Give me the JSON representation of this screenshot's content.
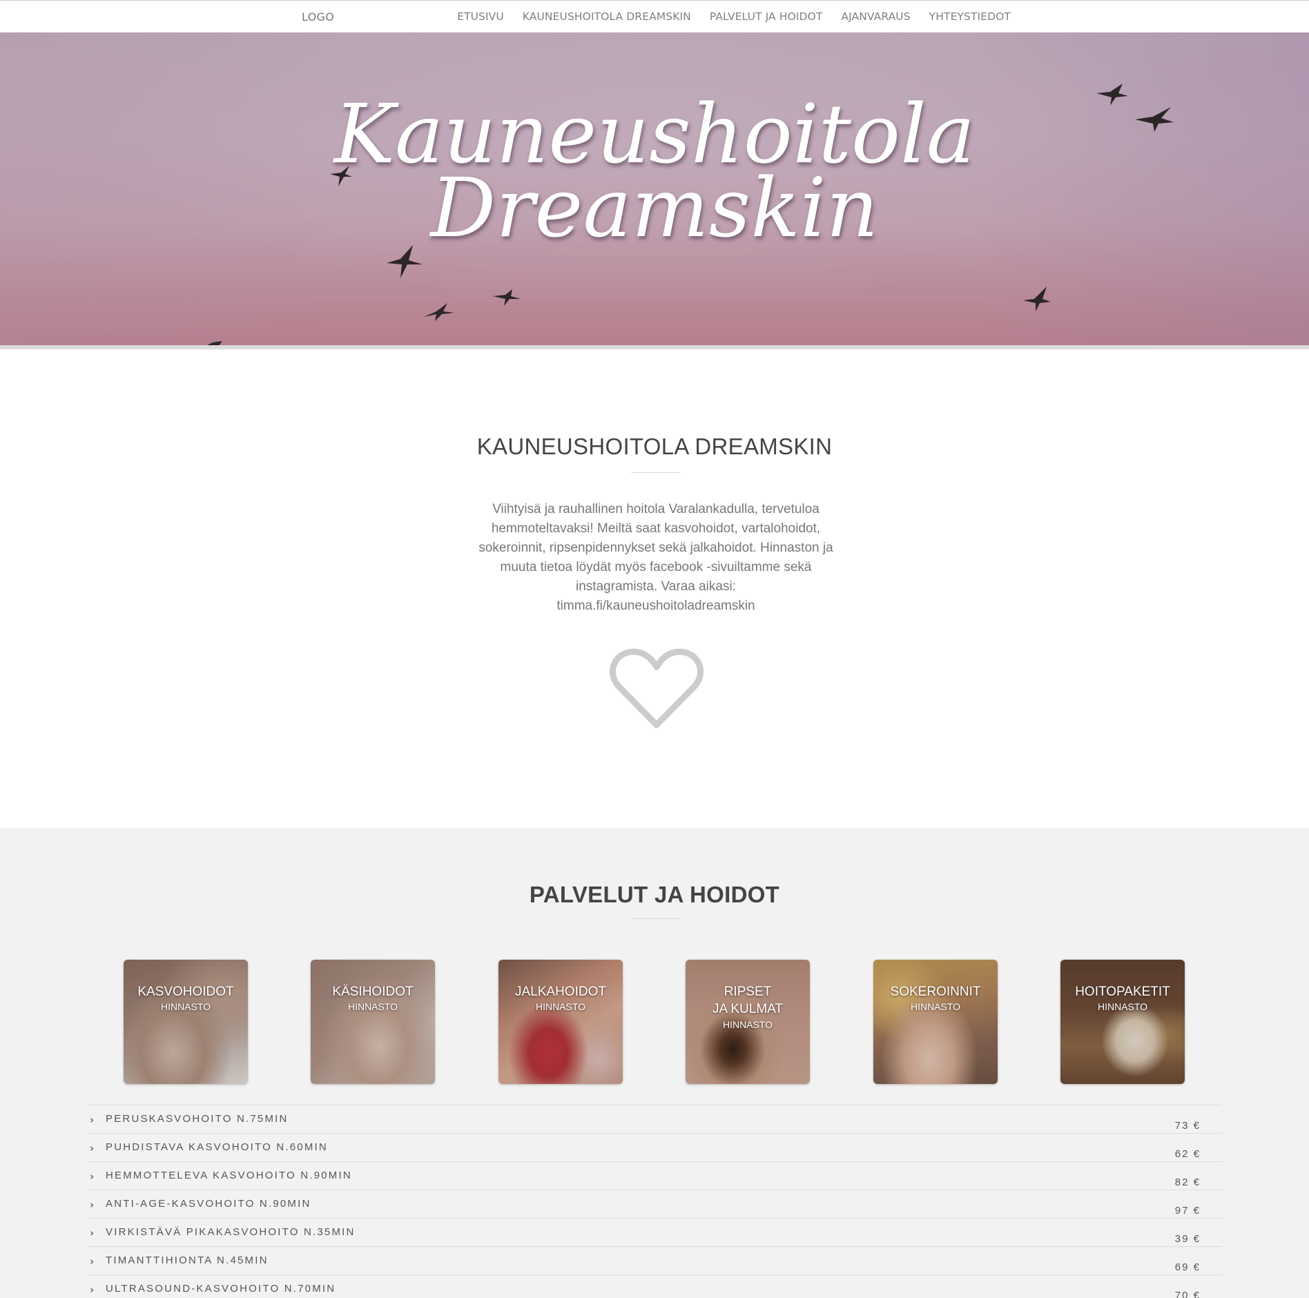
{
  "nav": {
    "logo": "LOGO",
    "items": [
      "ETUSIVU",
      "KAUNEUSHOITOLA DREAMSKIN",
      "PALVELUT JA HOIDOT",
      "AJANVARAUS",
      "YHTEYSTIEDOT"
    ]
  },
  "hero": {
    "line1": "Kauneushoitola",
    "line2": "Dreamskin"
  },
  "intro": {
    "title": "KAUNEUSHOITOLA DREAMSKIN",
    "text": "Viihtyisä ja rauhallinen hoitola Varalankadulla, tervetuloa hemmoteltavaksi! Meiltä saat kasvohoidot, vartalohoidot, sokeroinnit, ripsenpidennykset sekä jalkahoidot. Hinnaston ja muuta tietoa löydät myös facebook -sivuiltamme sekä instagramista. Varaa aikasi: timma.fi/kauneushoitoladreamskin",
    "icon": "heart-icon"
  },
  "services": {
    "title": "PALVELUT JA HOIDOT",
    "cards": [
      {
        "name": "KASVOHOIDOT",
        "sub": "HINNASTO"
      },
      {
        "name": "KÄSIHOIDOT",
        "sub": "HINNASTO"
      },
      {
        "name": "JALKAHOIDOT",
        "sub": "HINNASTO"
      },
      {
        "name": "RIPSET\nJA KULMAT",
        "sub": "HINNASTO"
      },
      {
        "name": "SOKEROINNIT",
        "sub": "HINNASTO"
      },
      {
        "name": "HOITOPAKETIT",
        "sub": "HINNASTO"
      }
    ],
    "prices": [
      {
        "name": "PERUSKASVOHOITO N.75MIN",
        "price": "73 €"
      },
      {
        "name": "PUHDISTAVA KASVOHOITO N.60MIN",
        "price": "62 €"
      },
      {
        "name": "HEMMOTTELEVA KASVOHOITO N.90MIN",
        "price": "82 €"
      },
      {
        "name": "ANTI-AGE-KASVOHOITO N.90MIN",
        "price": "97 €"
      },
      {
        "name": "VIRKISTÄVÄ PIKAKASVOHOITO N.35MIN",
        "price": "39 €"
      },
      {
        "name": "TIMANTTIHIONTA N.45MIN",
        "price": "69 €"
      },
      {
        "name": "ULTRASOUND-KASVOHOITO N.70MIN",
        "price": "70 €"
      }
    ]
  },
  "colors": {
    "hero_top": "#b7a3b4",
    "hero_bottom": "#b67f8e",
    "services_bg": "#f2f2f2"
  }
}
